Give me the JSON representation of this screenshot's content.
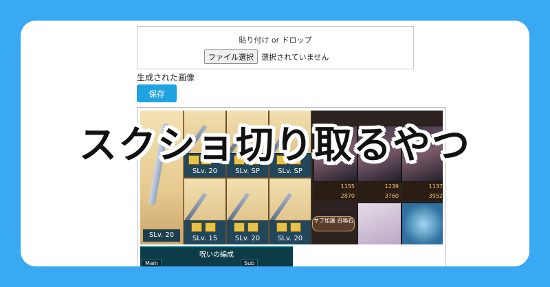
{
  "upload": {
    "hint": "貼り付け or ドロップ",
    "file_button": "ファイル選択",
    "file_status": "選択されていません"
  },
  "output": {
    "label": "生成された画像",
    "save_button": "保存"
  },
  "preview": {
    "main_slv": "SLv. 20",
    "slots": [
      {
        "sl": "SLv. 20"
      },
      {
        "sl": "SLv. SP"
      },
      {
        "sl": "SLv. SP"
      },
      {
        "sl": "SLv. 15"
      },
      {
        "sl": "SLv. 20"
      },
      {
        "sl": "SLv. 20"
      }
    ],
    "stats": [
      {
        "hp": "1155",
        "atk": "2870"
      },
      {
        "hp": "1239",
        "atk": "3760"
      },
      {
        "hp": "1137",
        "atk": "3952"
      }
    ],
    "sub_summon_button": "サブ加護 召喚石",
    "formation_title": "呪いの編成",
    "tab_main": "Main",
    "tab_sub": "Sub"
  },
  "headline": "スクショ切り取るやつ",
  "colors": {
    "background": "#3aa9f4",
    "card": "#ffffff",
    "save_button": "#1fa2e0"
  }
}
